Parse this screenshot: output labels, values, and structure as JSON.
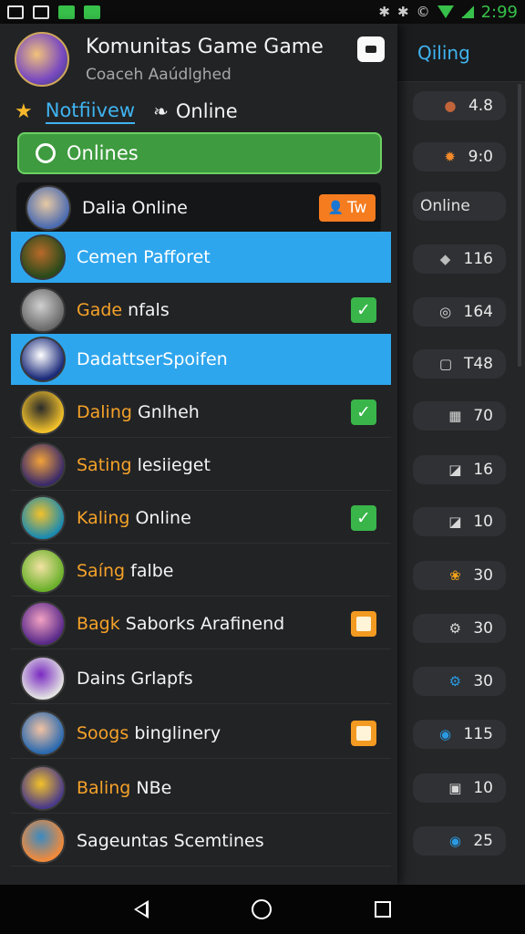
{
  "status_bar": {
    "time": "2:99"
  },
  "header": {
    "title": "Komunitas Game Game",
    "subtitle": "Coaceh Aaúdlghed"
  },
  "tabs": [
    {
      "label": "Notfiivew",
      "active": true
    },
    {
      "label": "Online",
      "active": false
    }
  ],
  "onlines_button": {
    "label": "Onlines"
  },
  "rows": [
    {
      "name": "Dalia Online",
      "highlight": "",
      "rest": "Dalia Online",
      "style": "card",
      "trailing": "badge",
      "badge_label": "Tw",
      "avatar": [
        "#4a6ab0",
        "#e7c9a3"
      ]
    },
    {
      "name": "Cemen Pafforet",
      "highlight": "",
      "rest": "Cemen Pafforet",
      "style": "selected",
      "trailing": "none",
      "avatar": [
        "#2a4a1a",
        "#b86a2a"
      ]
    },
    {
      "name": "Gade nfals",
      "highlight": "Gade",
      "rest": " nfals",
      "style": "normal",
      "trailing": "check",
      "avatar": [
        "#6a6a6a",
        "#cfcfcf"
      ]
    },
    {
      "name": "DadattserSpoifen",
      "highlight": "",
      "rest": "DadattserSpoifen",
      "style": "selected",
      "trailing": "none",
      "avatar": [
        "#1a2a7a",
        "#ffffff"
      ]
    },
    {
      "name": "Daling Gnlheh",
      "highlight": "Daling",
      "rest": " Gnlheh",
      "style": "normal",
      "trailing": "check",
      "avatar": [
        "#f2c12a",
        "#2a2a2a"
      ]
    },
    {
      "name": "Sating lesiieget",
      "highlight": "Sating",
      "rest": " lesiieget",
      "style": "normal",
      "trailing": "none",
      "avatar": [
        "#3a2a6a",
        "#f2a23a"
      ]
    },
    {
      "name": "Kaling Online",
      "highlight": "Kaling",
      "rest": " Online",
      "style": "normal",
      "trailing": "check",
      "avatar": [
        "#1a8ab0",
        "#f2c12a"
      ]
    },
    {
      "name": "Saíng falbe",
      "highlight": "Saíng",
      "rest": " falbe",
      "style": "normal",
      "trailing": "none",
      "avatar": [
        "#6ab02a",
        "#f2e2a3"
      ]
    },
    {
      "name": "Bagk Saborks Arafinend",
      "highlight": "Bagk",
      "rest": " Saborks Arafinend",
      "style": "normal",
      "trailing": "orange",
      "avatar": [
        "#5a2a8a",
        "#f2a2c2"
      ]
    },
    {
      "name": "Dains Grlapfs",
      "highlight": "",
      "rest": "Dains Grlapfs",
      "style": "normal",
      "trailing": "none",
      "avatar": [
        "#e2e2e2",
        "#7a2ac2"
      ]
    },
    {
      "name": "Soogs binglinery",
      "highlight": "Soogs",
      "rest": " binglinery",
      "style": "normal",
      "trailing": "orange",
      "avatar": [
        "#2a6ab0",
        "#f2c2a3"
      ]
    },
    {
      "name": "Baling NBe",
      "highlight": "Baling",
      "rest": " NBe",
      "style": "normal",
      "trailing": "none",
      "avatar": [
        "#4a3a8a",
        "#f2c12a"
      ]
    },
    {
      "name": "Sageuntas Scemtines",
      "highlight": "",
      "rest": "Sageuntas Scemtines",
      "style": "normal",
      "trailing": "none",
      "avatar": [
        "#f28a3a",
        "#3a8ac2"
      ]
    }
  ],
  "right_panel": {
    "header": "Qiling",
    "items": [
      {
        "icon": "●",
        "icon_color": "#c2643a",
        "value": "4.8"
      },
      {
        "icon": "✹",
        "icon_color": "#f28a2a",
        "value": "9:0"
      },
      {
        "icon": "",
        "icon_color": "",
        "value": "Online",
        "text": true
      },
      {
        "icon": "◆",
        "icon_color": "#bcbcbc",
        "value": "116"
      },
      {
        "icon": "◎",
        "icon_color": "#d8d8d8",
        "value": "164"
      },
      {
        "icon": "▢",
        "icon_color": "#d8d8d8",
        "value": "T48"
      },
      {
        "icon": "▦",
        "icon_color": "#d8d8d8",
        "value": "70"
      },
      {
        "icon": "◪",
        "icon_color": "#d8d8d8",
        "value": "16"
      },
      {
        "icon": "◪",
        "icon_color": "#d8d8d8",
        "value": "10"
      },
      {
        "icon": "❀",
        "icon_color": "#f2a21a",
        "value": "30"
      },
      {
        "icon": "⚙",
        "icon_color": "#d8d8d8",
        "value": "30"
      },
      {
        "icon": "⚙",
        "icon_color": "#2a9ae2",
        "value": "30"
      },
      {
        "icon": "◉",
        "icon_color": "#2a9ae2",
        "value": "115"
      },
      {
        "icon": "▣",
        "icon_color": "#d8d8d8",
        "value": "10"
      },
      {
        "icon": "◉",
        "icon_color": "#2a9ae2",
        "value": "25"
      }
    ]
  }
}
